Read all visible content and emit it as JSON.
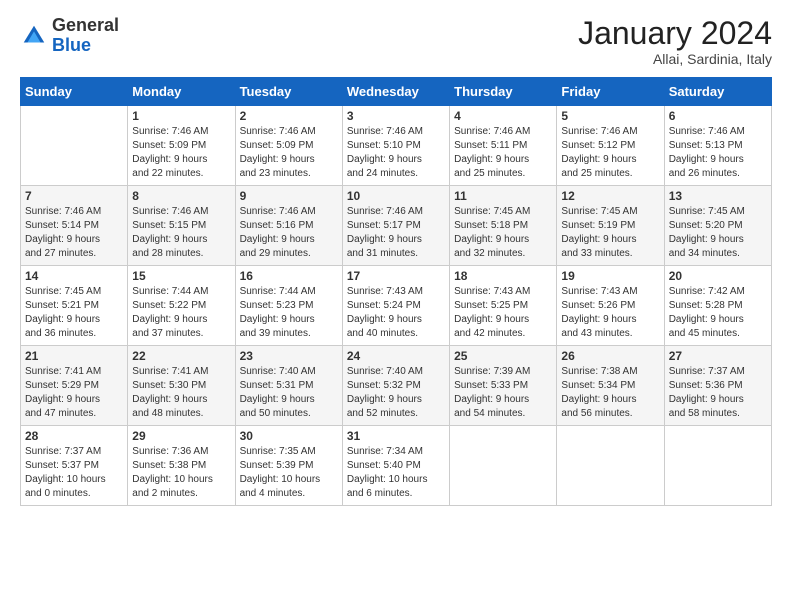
{
  "logo": {
    "general": "General",
    "blue": "Blue"
  },
  "title": "January 2024",
  "subtitle": "Allai, Sardinia, Italy",
  "days_of_week": [
    "Sunday",
    "Monday",
    "Tuesday",
    "Wednesday",
    "Thursday",
    "Friday",
    "Saturday"
  ],
  "weeks": [
    [
      {
        "day": "",
        "info": ""
      },
      {
        "day": "1",
        "info": "Sunrise: 7:46 AM\nSunset: 5:09 PM\nDaylight: 9 hours\nand 22 minutes."
      },
      {
        "day": "2",
        "info": "Sunrise: 7:46 AM\nSunset: 5:09 PM\nDaylight: 9 hours\nand 23 minutes."
      },
      {
        "day": "3",
        "info": "Sunrise: 7:46 AM\nSunset: 5:10 PM\nDaylight: 9 hours\nand 24 minutes."
      },
      {
        "day": "4",
        "info": "Sunrise: 7:46 AM\nSunset: 5:11 PM\nDaylight: 9 hours\nand 25 minutes."
      },
      {
        "day": "5",
        "info": "Sunrise: 7:46 AM\nSunset: 5:12 PM\nDaylight: 9 hours\nand 25 minutes."
      },
      {
        "day": "6",
        "info": "Sunrise: 7:46 AM\nSunset: 5:13 PM\nDaylight: 9 hours\nand 26 minutes."
      }
    ],
    [
      {
        "day": "7",
        "info": "Sunrise: 7:46 AM\nSunset: 5:14 PM\nDaylight: 9 hours\nand 27 minutes."
      },
      {
        "day": "8",
        "info": "Sunrise: 7:46 AM\nSunset: 5:15 PM\nDaylight: 9 hours\nand 28 minutes."
      },
      {
        "day": "9",
        "info": "Sunrise: 7:46 AM\nSunset: 5:16 PM\nDaylight: 9 hours\nand 29 minutes."
      },
      {
        "day": "10",
        "info": "Sunrise: 7:46 AM\nSunset: 5:17 PM\nDaylight: 9 hours\nand 31 minutes."
      },
      {
        "day": "11",
        "info": "Sunrise: 7:45 AM\nSunset: 5:18 PM\nDaylight: 9 hours\nand 32 minutes."
      },
      {
        "day": "12",
        "info": "Sunrise: 7:45 AM\nSunset: 5:19 PM\nDaylight: 9 hours\nand 33 minutes."
      },
      {
        "day": "13",
        "info": "Sunrise: 7:45 AM\nSunset: 5:20 PM\nDaylight: 9 hours\nand 34 minutes."
      }
    ],
    [
      {
        "day": "14",
        "info": "Sunrise: 7:45 AM\nSunset: 5:21 PM\nDaylight: 9 hours\nand 36 minutes."
      },
      {
        "day": "15",
        "info": "Sunrise: 7:44 AM\nSunset: 5:22 PM\nDaylight: 9 hours\nand 37 minutes."
      },
      {
        "day": "16",
        "info": "Sunrise: 7:44 AM\nSunset: 5:23 PM\nDaylight: 9 hours\nand 39 minutes."
      },
      {
        "day": "17",
        "info": "Sunrise: 7:43 AM\nSunset: 5:24 PM\nDaylight: 9 hours\nand 40 minutes."
      },
      {
        "day": "18",
        "info": "Sunrise: 7:43 AM\nSunset: 5:25 PM\nDaylight: 9 hours\nand 42 minutes."
      },
      {
        "day": "19",
        "info": "Sunrise: 7:43 AM\nSunset: 5:26 PM\nDaylight: 9 hours\nand 43 minutes."
      },
      {
        "day": "20",
        "info": "Sunrise: 7:42 AM\nSunset: 5:28 PM\nDaylight: 9 hours\nand 45 minutes."
      }
    ],
    [
      {
        "day": "21",
        "info": "Sunrise: 7:41 AM\nSunset: 5:29 PM\nDaylight: 9 hours\nand 47 minutes."
      },
      {
        "day": "22",
        "info": "Sunrise: 7:41 AM\nSunset: 5:30 PM\nDaylight: 9 hours\nand 48 minutes."
      },
      {
        "day": "23",
        "info": "Sunrise: 7:40 AM\nSunset: 5:31 PM\nDaylight: 9 hours\nand 50 minutes."
      },
      {
        "day": "24",
        "info": "Sunrise: 7:40 AM\nSunset: 5:32 PM\nDaylight: 9 hours\nand 52 minutes."
      },
      {
        "day": "25",
        "info": "Sunrise: 7:39 AM\nSunset: 5:33 PM\nDaylight: 9 hours\nand 54 minutes."
      },
      {
        "day": "26",
        "info": "Sunrise: 7:38 AM\nSunset: 5:34 PM\nDaylight: 9 hours\nand 56 minutes."
      },
      {
        "day": "27",
        "info": "Sunrise: 7:37 AM\nSunset: 5:36 PM\nDaylight: 9 hours\nand 58 minutes."
      }
    ],
    [
      {
        "day": "28",
        "info": "Sunrise: 7:37 AM\nSunset: 5:37 PM\nDaylight: 10 hours\nand 0 minutes."
      },
      {
        "day": "29",
        "info": "Sunrise: 7:36 AM\nSunset: 5:38 PM\nDaylight: 10 hours\nand 2 minutes."
      },
      {
        "day": "30",
        "info": "Sunrise: 7:35 AM\nSunset: 5:39 PM\nDaylight: 10 hours\nand 4 minutes."
      },
      {
        "day": "31",
        "info": "Sunrise: 7:34 AM\nSunset: 5:40 PM\nDaylight: 10 hours\nand 6 minutes."
      },
      {
        "day": "",
        "info": ""
      },
      {
        "day": "",
        "info": ""
      },
      {
        "day": "",
        "info": ""
      }
    ]
  ]
}
